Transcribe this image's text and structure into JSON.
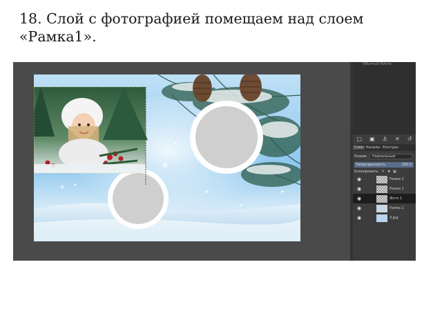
{
  "caption": {
    "text": "18. Слой с фотографией помещаем  над слоем «Рамка1»."
  },
  "dock": {
    "top_title": "Обычные Кисти",
    "toolbar_icons": [
      "new-layer-icon",
      "layer-group-icon",
      "anchor-icon",
      "delete-icon",
      "undo-icon"
    ],
    "tabs": [
      "Слои",
      "Каналы",
      "Контуры"
    ],
    "mode_label": "Режим",
    "mode_value": "Нормальный",
    "opacity_label": "Непрозрачность",
    "opacity_value": "100.0",
    "lock_label": "Блокировать:",
    "lock_icons": [
      "pencil-lock-icon",
      "move-lock-icon",
      "alpha-lock-icon"
    ]
  },
  "layers": [
    {
      "name": "Рамка 2",
      "active": false,
      "thumb": "transparent"
    },
    {
      "name": "Рамка 1",
      "active": false,
      "thumb": "transparent"
    },
    {
      "name": "Фото 1",
      "active": true,
      "thumb": "transparent"
    },
    {
      "name": "Рамка 1",
      "active": false,
      "thumb": "mini-photo"
    },
    {
      "name": "3.jpg",
      "active": false,
      "thumb": "photo"
    }
  ],
  "colors": {
    "workspace": "#4a4a4a",
    "dock": "#3c3c3c",
    "active_layer": "#1d1d1d",
    "frame_fill": "#cfcfcf",
    "frame_ring": "#ffffff"
  }
}
